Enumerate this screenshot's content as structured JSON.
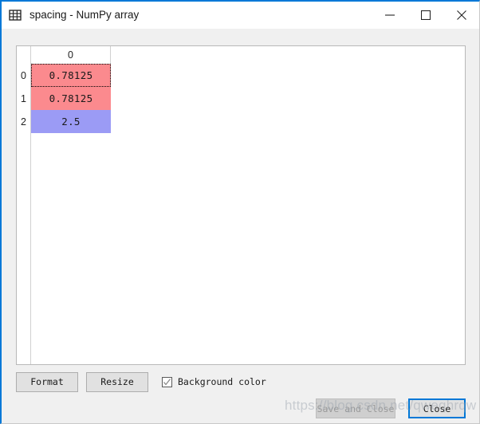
{
  "window": {
    "title": "spacing - NumPy array",
    "icon": "table-grid-icon",
    "accent_color": "#0078d7",
    "controls": {
      "minimize": "—",
      "maximize": "☐",
      "close": "✕"
    }
  },
  "table": {
    "column_headers": [
      "0"
    ],
    "row_headers": [
      "0",
      "1",
      "2"
    ],
    "rows": [
      {
        "index": "0",
        "cells": [
          {
            "value": "0.78125",
            "bg": "#fb8a8e",
            "selected": true
          }
        ]
      },
      {
        "index": "1",
        "cells": [
          {
            "value": "0.78125",
            "bg": "#fb8a8e",
            "selected": false
          }
        ]
      },
      {
        "index": "2",
        "cells": [
          {
            "value": "2.5",
            "bg": "#9b9bf5",
            "selected": false
          }
        ]
      }
    ]
  },
  "toolbar": {
    "format_label": "Format",
    "resize_label": "Resize",
    "background_color_label": "Background color",
    "background_color_checked": true,
    "check_glyph": "✓"
  },
  "actions": {
    "save_and_close_label": "Save and Close",
    "save_and_close_enabled": false,
    "close_label": "Close",
    "close_focused": true
  },
  "watermark": {
    "text": "https://blog.csdn.net/qweqhrqw"
  }
}
